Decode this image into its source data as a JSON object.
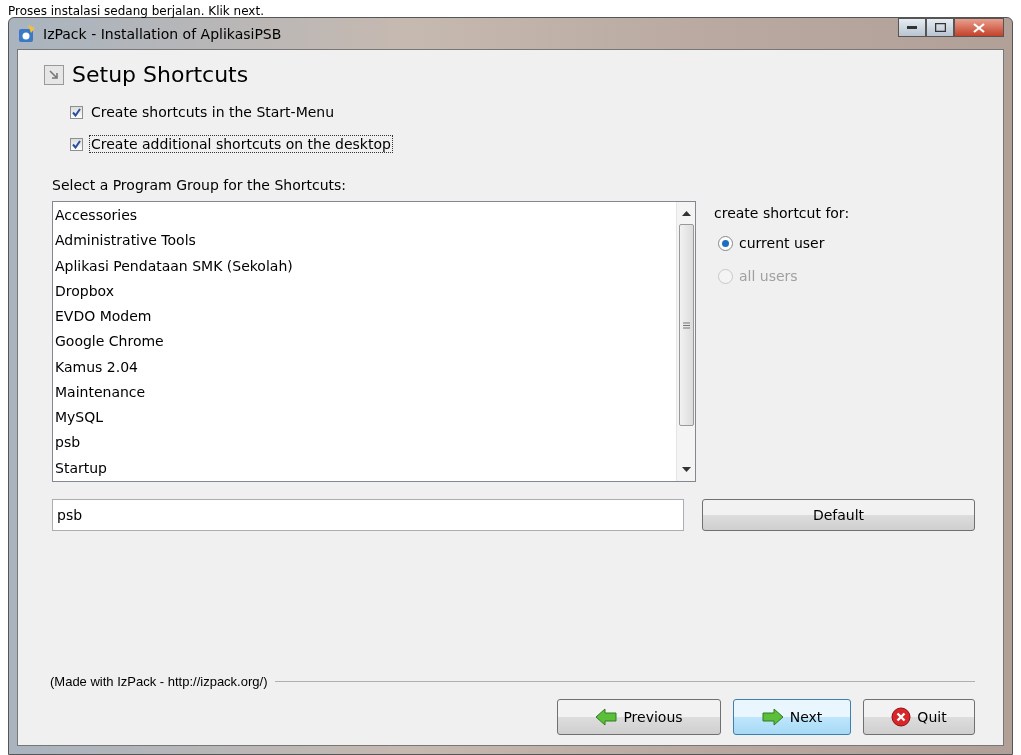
{
  "caption": "Proses instalasi sedang berjalan. Klik next.",
  "window": {
    "title": "IzPack - Installation of AplikasiPSB"
  },
  "panel": {
    "title": "Setup Shortcuts"
  },
  "options": [
    {
      "label": "Create shortcuts in the Start-Menu",
      "checked": true,
      "focused": false
    },
    {
      "label": "Create additional shortcuts on the desktop",
      "checked": true,
      "focused": true
    }
  ],
  "group_label": "Select a Program Group for the Shortcuts:",
  "program_groups": [
    {
      "label": "Accessories",
      "selected": false
    },
    {
      "label": "Administrative Tools",
      "selected": false
    },
    {
      "label": "Aplikasi Pendataan SMK (Sekolah)",
      "selected": false
    },
    {
      "label": "Dropbox",
      "selected": false
    },
    {
      "label": "EVDO Modem",
      "selected": false
    },
    {
      "label": "Google Chrome",
      "selected": false
    },
    {
      "label": "Kamus 2.04",
      "selected": false
    },
    {
      "label": "Maintenance",
      "selected": false
    },
    {
      "label": "MySQL",
      "selected": false
    },
    {
      "label": "psb",
      "selected": false
    },
    {
      "label": "Startup",
      "selected": false
    }
  ],
  "group_field": {
    "value": "psb"
  },
  "default_button": "Default",
  "shortcut_for": {
    "label": "create shortcut for:",
    "options": [
      {
        "label": "current user",
        "selected": true,
        "disabled": false
      },
      {
        "label": "all users",
        "selected": false,
        "disabled": true
      }
    ]
  },
  "footer": "(Made with IzPack - http://izpack.org/)",
  "buttons": [
    {
      "label": "Previous",
      "kind": "previous",
      "highlighted": false
    },
    {
      "label": "Next",
      "kind": "next",
      "highlighted": true
    },
    {
      "label": "Quit",
      "kind": "quit",
      "highlighted": false
    }
  ]
}
